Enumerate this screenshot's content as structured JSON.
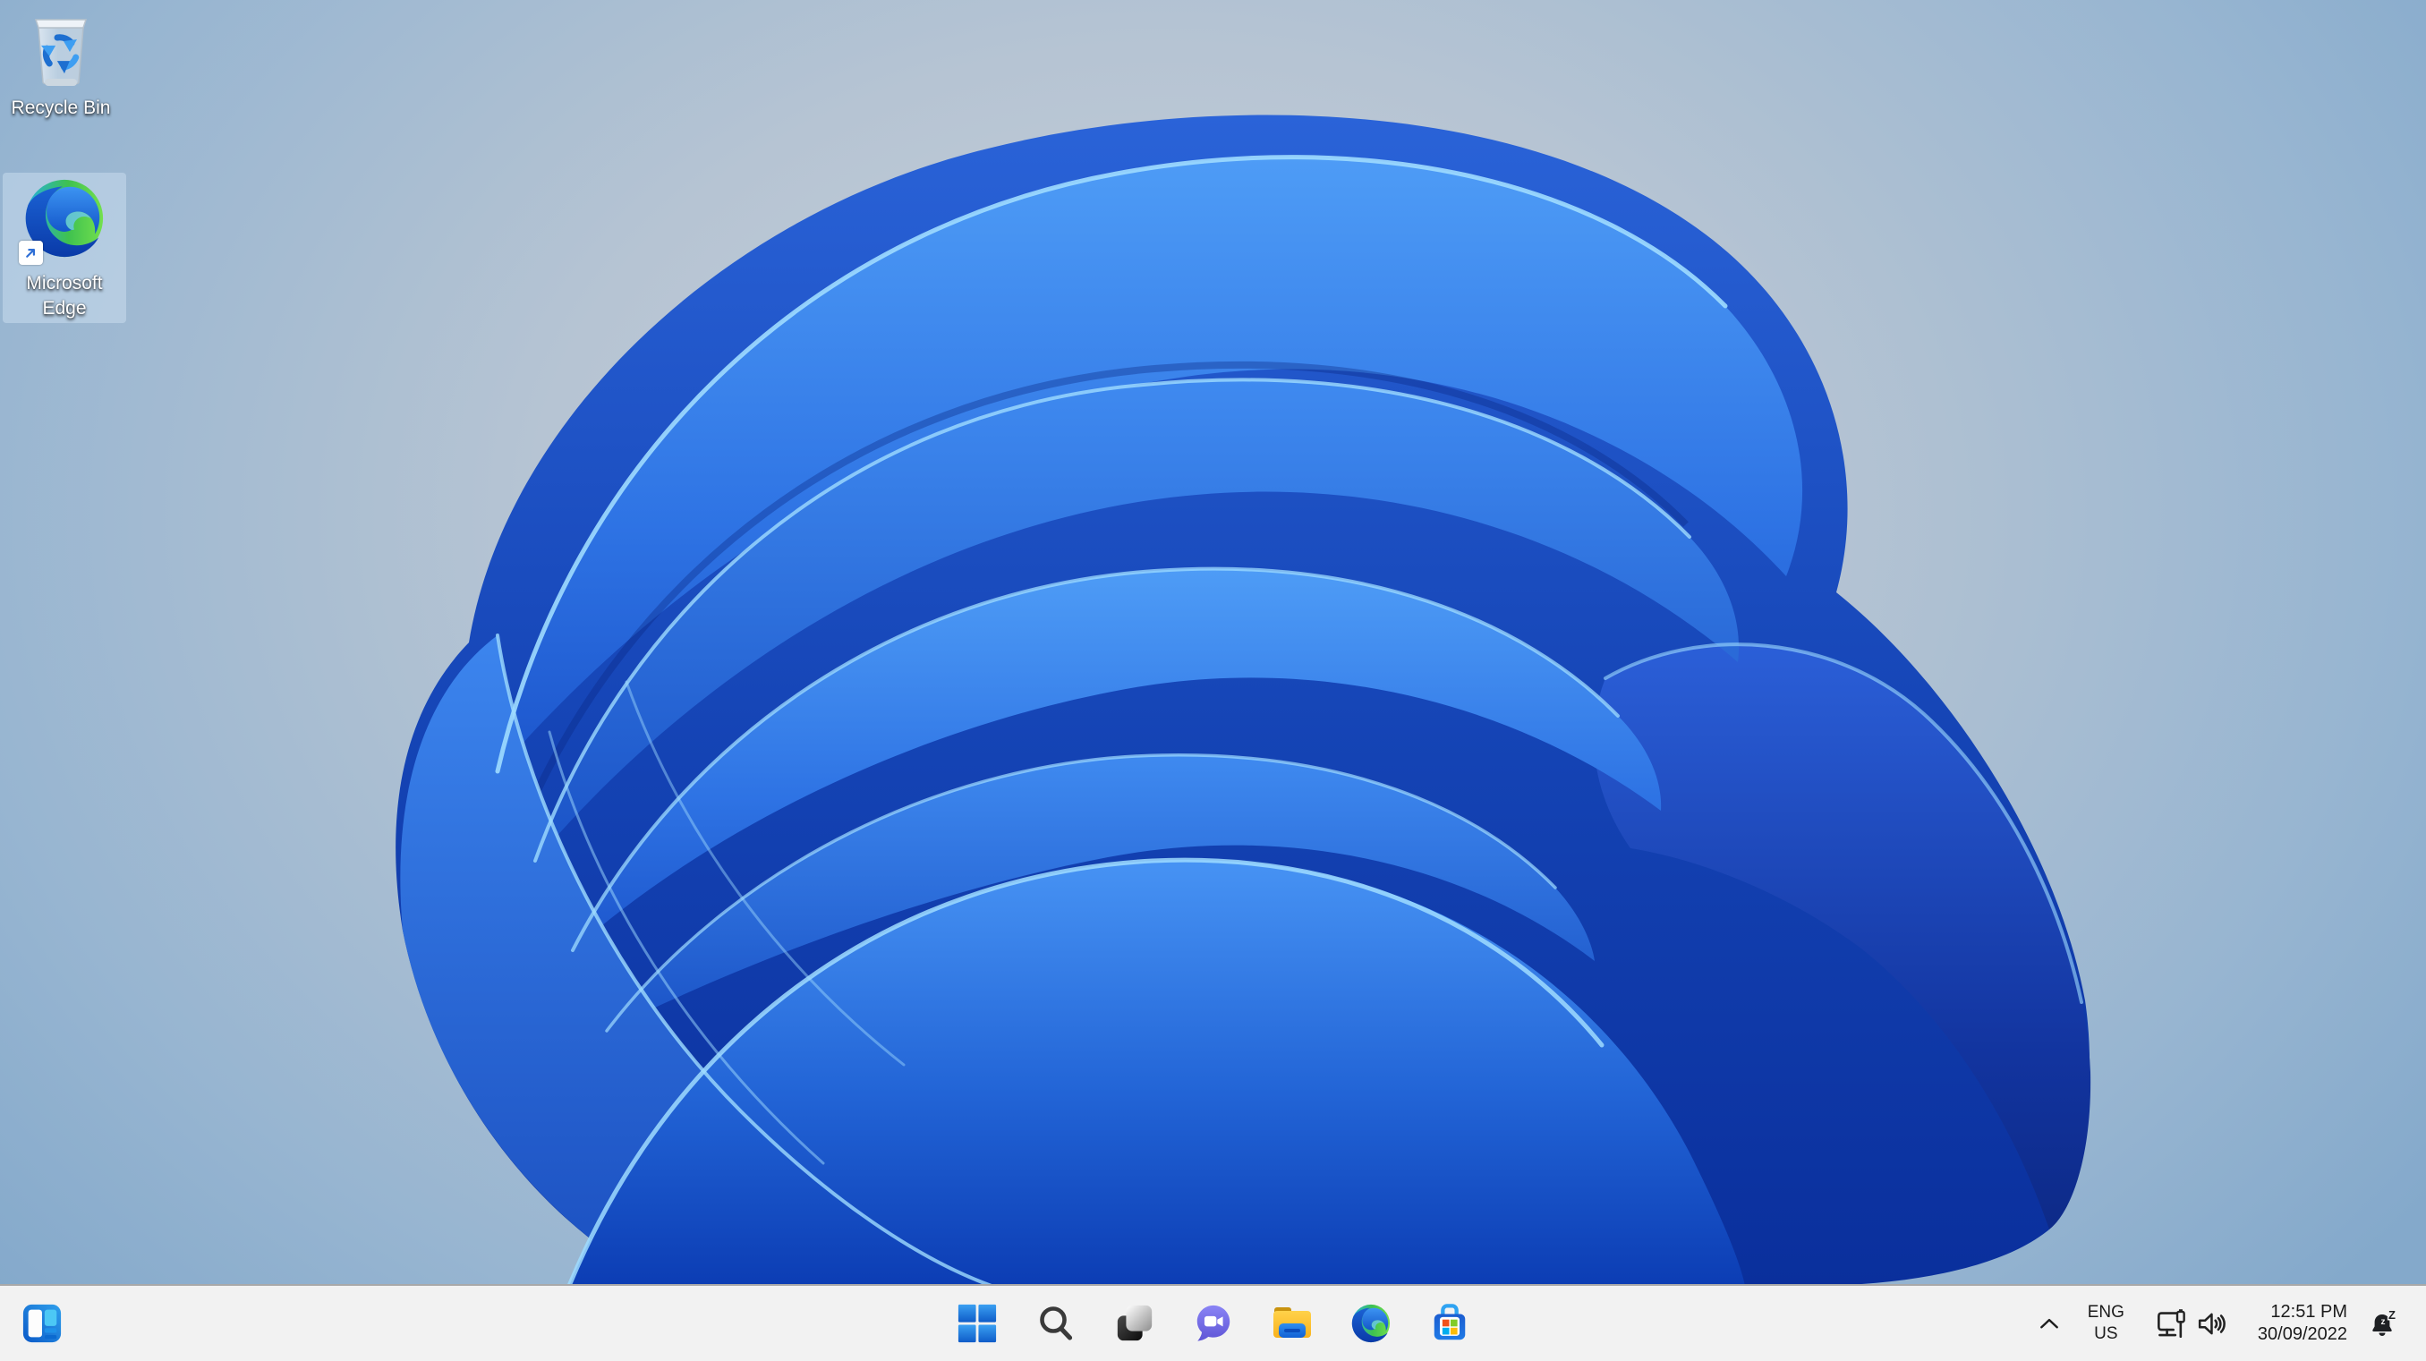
{
  "desktop": {
    "icons": [
      {
        "id": "recycle-bin",
        "label": "Recycle Bin",
        "icon": "recycle-bin-icon",
        "selected": false
      },
      {
        "id": "microsoft-edge",
        "label": "Microsoft Edge",
        "icon": "edge-logo-icon",
        "selected": true,
        "shortcut": true
      }
    ]
  },
  "taskbar": {
    "widgets_button": {
      "icon": "widgets-icon"
    },
    "center_buttons": [
      {
        "name": "start",
        "icon": "windows-start-icon"
      },
      {
        "name": "search",
        "icon": "search-icon"
      },
      {
        "name": "task-view",
        "icon": "task-view-icon"
      },
      {
        "name": "chat",
        "icon": "teams-chat-icon"
      },
      {
        "name": "file-explorer",
        "icon": "folder-icon"
      },
      {
        "name": "microsoft-edge",
        "icon": "edge-icon"
      },
      {
        "name": "microsoft-store",
        "icon": "store-bag-icon"
      }
    ],
    "tray": {
      "hidden_icons": {
        "icon": "chevron-up-icon"
      },
      "language": {
        "line1": "ENG",
        "line2": "US"
      },
      "network": {
        "icon": "wired-network-icon"
      },
      "volume": {
        "icon": "speaker-icon"
      },
      "clock": {
        "time": "12:51 PM",
        "date": "30/09/2022"
      },
      "notifications": {
        "icon": "bell-do-not-disturb-icon"
      }
    }
  },
  "colors": {
    "taskbar_background": "#f2f2f2",
    "taskbar_border": "#a9a9a9",
    "selection_highlight": "rgba(210,228,245,0.45)",
    "background_sky": "#a9c2dc",
    "bloom_primary": "#2a63d8",
    "bloom_deep": "#0a2f9c",
    "bloom_highlight": "#9fdcff"
  }
}
